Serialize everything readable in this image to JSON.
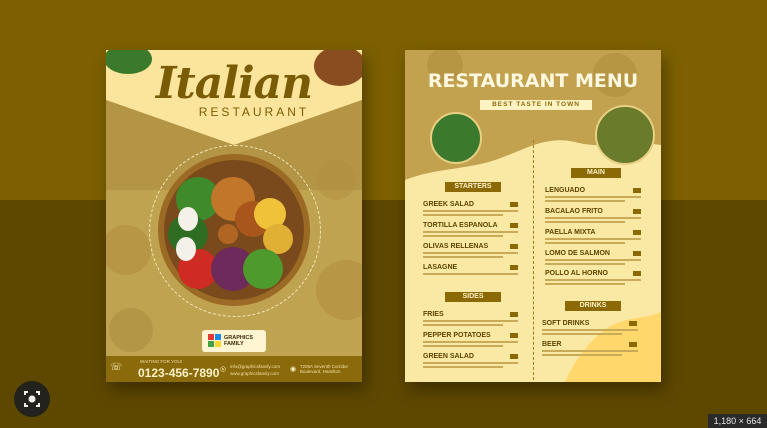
{
  "viewer": {
    "dimensions_badge": "1,180 × 664",
    "lens_button": "visual-search"
  },
  "left_flyer": {
    "title": "Italian",
    "subtitle": "RESTAURANT",
    "logo_line1": "GRAPHICS",
    "logo_line2": "FAMILY",
    "footer": {
      "waiting_text": "WAITING FOR YOU!",
      "phone": "0123-456-7890",
      "email": "info@graphicsfamily.com",
      "website": "www.graphicsfamily.com",
      "address": "7208A Seventh Corridor Boulevard, Hamilton"
    }
  },
  "right_flyer": {
    "title": "RESTAURANT MENU",
    "tagline": "BEST TASTE IN TOWN",
    "sections": {
      "starters": {
        "label": "STARTERS",
        "items": [
          "GREEK SALAD",
          "TORTILLA ESPANOLA",
          "OLIVAS RELLENAS",
          "LASAGNE"
        ]
      },
      "main": {
        "label": "MAIN",
        "items": [
          "LENGUADO",
          "BACALAO FRITO",
          "PAELLA MIXTA",
          "LOMO DE SALMON",
          "POLLO AL HORNO"
        ]
      },
      "sides": {
        "label": "SIDES",
        "items": [
          "FRIES",
          "PEPPER POTATOES",
          "GREEN SALAD"
        ]
      },
      "drinks": {
        "label": "DRINKS",
        "items": [
          "SOFT DRINKS",
          "BEER"
        ]
      }
    }
  },
  "colors": {
    "background_top": "#7d6002",
    "background_bottom": "#5e4800",
    "flyer_gold": "#c0a350",
    "flyer_cream": "#fae8a5",
    "accent_brown": "#8b6a05"
  }
}
